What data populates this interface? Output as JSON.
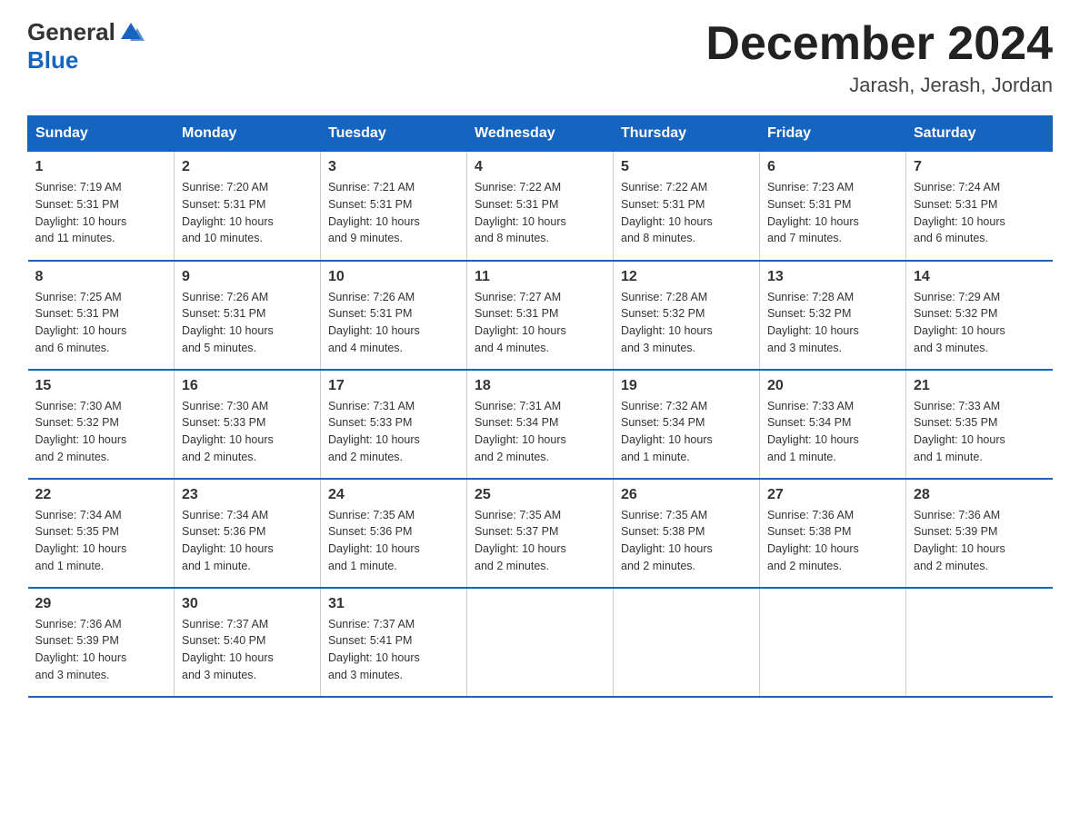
{
  "header": {
    "logo": {
      "general": "General",
      "blue": "Blue"
    },
    "title": "December 2024",
    "subtitle": "Jarash, Jerash, Jordan"
  },
  "days_of_week": [
    "Sunday",
    "Monday",
    "Tuesday",
    "Wednesday",
    "Thursday",
    "Friday",
    "Saturday"
  ],
  "weeks": [
    [
      {
        "day": "1",
        "sunrise": "7:19 AM",
        "sunset": "5:31 PM",
        "daylight": "10 hours and 11 minutes."
      },
      {
        "day": "2",
        "sunrise": "7:20 AM",
        "sunset": "5:31 PM",
        "daylight": "10 hours and 10 minutes."
      },
      {
        "day": "3",
        "sunrise": "7:21 AM",
        "sunset": "5:31 PM",
        "daylight": "10 hours and 9 minutes."
      },
      {
        "day": "4",
        "sunrise": "7:22 AM",
        "sunset": "5:31 PM",
        "daylight": "10 hours and 8 minutes."
      },
      {
        "day": "5",
        "sunrise": "7:22 AM",
        "sunset": "5:31 PM",
        "daylight": "10 hours and 8 minutes."
      },
      {
        "day": "6",
        "sunrise": "7:23 AM",
        "sunset": "5:31 PM",
        "daylight": "10 hours and 7 minutes."
      },
      {
        "day": "7",
        "sunrise": "7:24 AM",
        "sunset": "5:31 PM",
        "daylight": "10 hours and 6 minutes."
      }
    ],
    [
      {
        "day": "8",
        "sunrise": "7:25 AM",
        "sunset": "5:31 PM",
        "daylight": "10 hours and 6 minutes."
      },
      {
        "day": "9",
        "sunrise": "7:26 AM",
        "sunset": "5:31 PM",
        "daylight": "10 hours and 5 minutes."
      },
      {
        "day": "10",
        "sunrise": "7:26 AM",
        "sunset": "5:31 PM",
        "daylight": "10 hours and 4 minutes."
      },
      {
        "day": "11",
        "sunrise": "7:27 AM",
        "sunset": "5:31 PM",
        "daylight": "10 hours and 4 minutes."
      },
      {
        "day": "12",
        "sunrise": "7:28 AM",
        "sunset": "5:32 PM",
        "daylight": "10 hours and 3 minutes."
      },
      {
        "day": "13",
        "sunrise": "7:28 AM",
        "sunset": "5:32 PM",
        "daylight": "10 hours and 3 minutes."
      },
      {
        "day": "14",
        "sunrise": "7:29 AM",
        "sunset": "5:32 PM",
        "daylight": "10 hours and 3 minutes."
      }
    ],
    [
      {
        "day": "15",
        "sunrise": "7:30 AM",
        "sunset": "5:32 PM",
        "daylight": "10 hours and 2 minutes."
      },
      {
        "day": "16",
        "sunrise": "7:30 AM",
        "sunset": "5:33 PM",
        "daylight": "10 hours and 2 minutes."
      },
      {
        "day": "17",
        "sunrise": "7:31 AM",
        "sunset": "5:33 PM",
        "daylight": "10 hours and 2 minutes."
      },
      {
        "day": "18",
        "sunrise": "7:31 AM",
        "sunset": "5:34 PM",
        "daylight": "10 hours and 2 minutes."
      },
      {
        "day": "19",
        "sunrise": "7:32 AM",
        "sunset": "5:34 PM",
        "daylight": "10 hours and 1 minute."
      },
      {
        "day": "20",
        "sunrise": "7:33 AM",
        "sunset": "5:34 PM",
        "daylight": "10 hours and 1 minute."
      },
      {
        "day": "21",
        "sunrise": "7:33 AM",
        "sunset": "5:35 PM",
        "daylight": "10 hours and 1 minute."
      }
    ],
    [
      {
        "day": "22",
        "sunrise": "7:34 AM",
        "sunset": "5:35 PM",
        "daylight": "10 hours and 1 minute."
      },
      {
        "day": "23",
        "sunrise": "7:34 AM",
        "sunset": "5:36 PM",
        "daylight": "10 hours and 1 minute."
      },
      {
        "day": "24",
        "sunrise": "7:35 AM",
        "sunset": "5:36 PM",
        "daylight": "10 hours and 1 minute."
      },
      {
        "day": "25",
        "sunrise": "7:35 AM",
        "sunset": "5:37 PM",
        "daylight": "10 hours and 2 minutes."
      },
      {
        "day": "26",
        "sunrise": "7:35 AM",
        "sunset": "5:38 PM",
        "daylight": "10 hours and 2 minutes."
      },
      {
        "day": "27",
        "sunrise": "7:36 AM",
        "sunset": "5:38 PM",
        "daylight": "10 hours and 2 minutes."
      },
      {
        "day": "28",
        "sunrise": "7:36 AM",
        "sunset": "5:39 PM",
        "daylight": "10 hours and 2 minutes."
      }
    ],
    [
      {
        "day": "29",
        "sunrise": "7:36 AM",
        "sunset": "5:39 PM",
        "daylight": "10 hours and 3 minutes."
      },
      {
        "day": "30",
        "sunrise": "7:37 AM",
        "sunset": "5:40 PM",
        "daylight": "10 hours and 3 minutes."
      },
      {
        "day": "31",
        "sunrise": "7:37 AM",
        "sunset": "5:41 PM",
        "daylight": "10 hours and 3 minutes."
      },
      null,
      null,
      null,
      null
    ]
  ],
  "labels": {
    "sunrise": "Sunrise:",
    "sunset": "Sunset:",
    "daylight": "Daylight:"
  }
}
